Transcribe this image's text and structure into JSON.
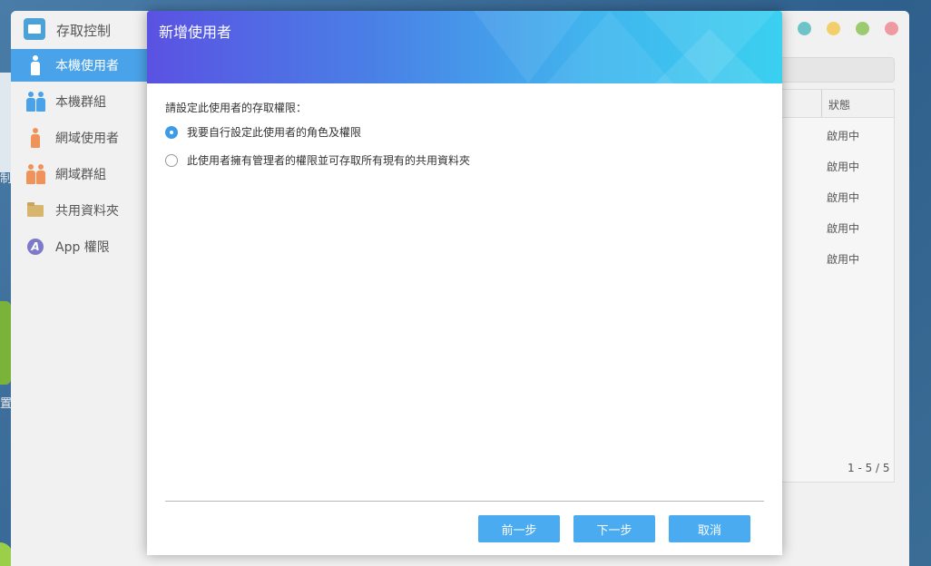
{
  "desktop": {
    "left_fragment_text_1": "制",
    "left_fragment_text_2": "置"
  },
  "main_window": {
    "title": "存取控制",
    "sidebar": {
      "items": [
        {
          "label": "本機使用者",
          "icon": "user-icon",
          "active": true
        },
        {
          "label": "本機群組",
          "icon": "group-icon",
          "active": false
        },
        {
          "label": "網域使用者",
          "icon": "domain-user-icon",
          "active": false
        },
        {
          "label": "網域群組",
          "icon": "domain-group-icon",
          "active": false
        },
        {
          "label": "共用資料夾",
          "icon": "folder-icon",
          "active": false
        },
        {
          "label": "App 權限",
          "icon": "app-icon",
          "active": false
        }
      ]
    },
    "table": {
      "status_header": "狀態",
      "rows": [
        {
          "status": "啟用中"
        },
        {
          "status": "啟用中"
        },
        {
          "status": "啟用中"
        },
        {
          "status": "啟用中"
        },
        {
          "status": "啟用中"
        }
      ],
      "pager": "1 - 5 / 5"
    }
  },
  "modal": {
    "title": "新增使用者",
    "prompt": "請設定此使用者的存取權限：",
    "options": [
      {
        "label": "我要自行設定此使用者的角色及權限",
        "selected": true
      },
      {
        "label": "此使用者擁有管理者的權限並可存取所有現有的共用資料夾",
        "selected": false
      }
    ],
    "buttons": {
      "back": "前一步",
      "next": "下一步",
      "cancel": "取消"
    }
  },
  "colors": {
    "accent": "#4aabf0",
    "sidebar_active": "#4aa3e8",
    "header_gradient_start": "#5a52e2",
    "header_gradient_end": "#3ad0f0"
  }
}
